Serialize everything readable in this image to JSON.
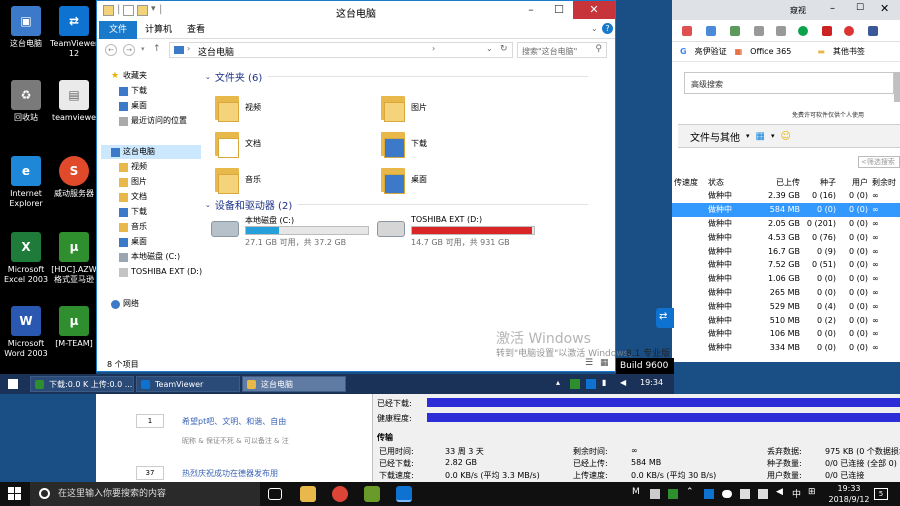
{
  "desktop": {
    "icons": [
      {
        "label": "这台电脑",
        "color": "#3c7ac9",
        "glyph": "▣"
      },
      {
        "label": "TeamViewer\n12",
        "color": "#0e72d0",
        "glyph": "⇄"
      },
      {
        "label": "回收站",
        "color": "#7a7a7a",
        "glyph": "♻"
      },
      {
        "label": "teamviewe",
        "color": "#eaeaea",
        "glyph": "▤"
      },
      {
        "label": "Internet\nExplorer",
        "color": "#1e87d8",
        "glyph": "e"
      },
      {
        "label": "威动服务器",
        "color": "#e04a2a",
        "glyph": "S"
      },
      {
        "label": "Microsoft\nExcel 2003",
        "color": "#1e7b3a",
        "glyph": "X"
      },
      {
        "label": "[HDC].AZW\n格式亚马逊",
        "color": "#2f8f2f",
        "glyph": "µ"
      },
      {
        "label": "Microsoft\nWord 2003",
        "color": "#2a57b0",
        "glyph": "W"
      },
      {
        "label": "[M-TEAM]",
        "color": "#2f8f2f",
        "glyph": "µ"
      }
    ]
  },
  "browser": {
    "tab_title": "窥视",
    "bookmarks": [
      "亮伊验证",
      "Office 365",
      "其他书签"
    ],
    "advanced_search": "高级搜索",
    "free_notice": "免费许可软件仅供个人使用",
    "files_label": "文件与其他",
    "filter_placeholder": "<筛选搜索",
    "table": {
      "headers": [
        "传速度",
        "状态",
        "已上传",
        "种子",
        "用户",
        "剩余时"
      ],
      "rows": [
        [
          "",
          "做种中",
          "2.39 GB",
          "0 (16)",
          "0 (0)",
          "∞"
        ],
        [
          "",
          "做种中",
          "584 MB",
          "0 (0)",
          "0 (0)",
          "∞"
        ],
        [
          "",
          "做种中",
          "2.05 GB",
          "0 (201)",
          "0 (0)",
          "∞"
        ],
        [
          "",
          "做种中",
          "4.53 GB",
          "0 (76)",
          "0 (0)",
          "∞"
        ],
        [
          "",
          "做种中",
          "16.7 GB",
          "0 (9)",
          "0 (0)",
          "∞"
        ],
        [
          "",
          "做种中",
          "7.52 GB",
          "0 (51)",
          "0 (0)",
          "∞"
        ],
        [
          "",
          "做种中",
          "1.06 GB",
          "0 (0)",
          "0 (0)",
          "∞"
        ],
        [
          "",
          "做种中",
          "265 MB",
          "0 (0)",
          "0 (0)",
          "∞"
        ],
        [
          "",
          "做种中",
          "529 MB",
          "0 (4)",
          "0 (0)",
          "∞"
        ],
        [
          "",
          "做种中",
          "510 MB",
          "0 (2)",
          "0 (0)",
          "∞"
        ],
        [
          "",
          "做种中",
          "106 MB",
          "0 (0)",
          "0 (0)",
          "∞"
        ],
        [
          "",
          "做种中",
          "334 MB",
          "0 (0)",
          "0 (0)",
          "∞"
        ]
      ]
    }
  },
  "explorer": {
    "title": "这台电脑",
    "ribbon_tabs": [
      "文件",
      "计算机",
      "查看"
    ],
    "address": "这台电脑",
    "search_placeholder": "搜索\"这台电脑\"",
    "nav": {
      "favorites": "收藏夹",
      "favorites_items": [
        "下载",
        "桌面",
        "最近访问的位置"
      ],
      "thispc": "这台电脑",
      "thispc_items": [
        "视频",
        "图片",
        "文档",
        "下载",
        "音乐",
        "桌面",
        "本地磁盘 (C:)",
        "TOSHIBA EXT (D:)"
      ],
      "network": "网络"
    },
    "folders_group": "文件夹 (6)",
    "folders": [
      "视频",
      "图片",
      "文档",
      "下载",
      "音乐",
      "桌面"
    ],
    "devices_group": "设备和驱动器 (2)",
    "drives": [
      {
        "name": "本地磁盘 (C:)",
        "info": "27.1 GB 可用，共 37.2 GB",
        "used_fraction": 0.27,
        "color": "#26a0da"
      },
      {
        "name": "TOSHIBA EXT (D:)",
        "info": "14.7 GB 可用，共 931 GB",
        "used_fraction": 0.98,
        "color": "#da2626"
      }
    ],
    "status": "8 个项目"
  },
  "watermark": {
    "line1": "激活 Windows",
    "line2": "转到\"电脑设置\"以激活 Windows。",
    "build_edition": "8.1 专业版",
    "build": "Build 9600"
  },
  "inner_taskbar": {
    "items": [
      "下载:0.0 K 上传:0.0 ...",
      "TeamViewer",
      "这台电脑"
    ],
    "clock": "19:34"
  },
  "lower_web": {
    "rows": [
      {
        "num": "1",
        "title": "希望pt吧、文明、和谐、自由",
        "sub": "昵称 & 保证不死 & 可以备注 & 注"
      },
      {
        "num": "37",
        "title": "热烈庆祝成功在德器发布朋",
        "sub": ""
      }
    ]
  },
  "stats": {
    "downloaded_label": "已经下载:",
    "health_label": "健康程度:",
    "transfer": "传输",
    "used_time_label": "已用时间:",
    "used_time": "33 周 3 天",
    "remaining_label": "剩余时间:",
    "remaining": "∞",
    "waste_label": "丢弃数据:",
    "waste": "975 KB (0 个数据损坏)",
    "dl_label": "已经下载:",
    "dl": "2.82 GB",
    "ul_label": "已经上传:",
    "ul": "584 MB",
    "seeds_label": "种子数量:",
    "seeds": "0/0 已连接 (全部 0)",
    "dlspeed_label": "下载速度:",
    "dlspeed": "0.0 KB/s (平均 3.3 MB/s)",
    "ulspeed_label": "上传速度:",
    "ulspeed": "0.0 KB/s (平均 30 B/s)",
    "users_label": "用户数量:",
    "users": "0/0 已连接"
  },
  "taskbar": {
    "search_placeholder": "在这里输入你要搜索的内容",
    "time": "19:33",
    "date": "2018/9/12",
    "notifications": "5"
  }
}
